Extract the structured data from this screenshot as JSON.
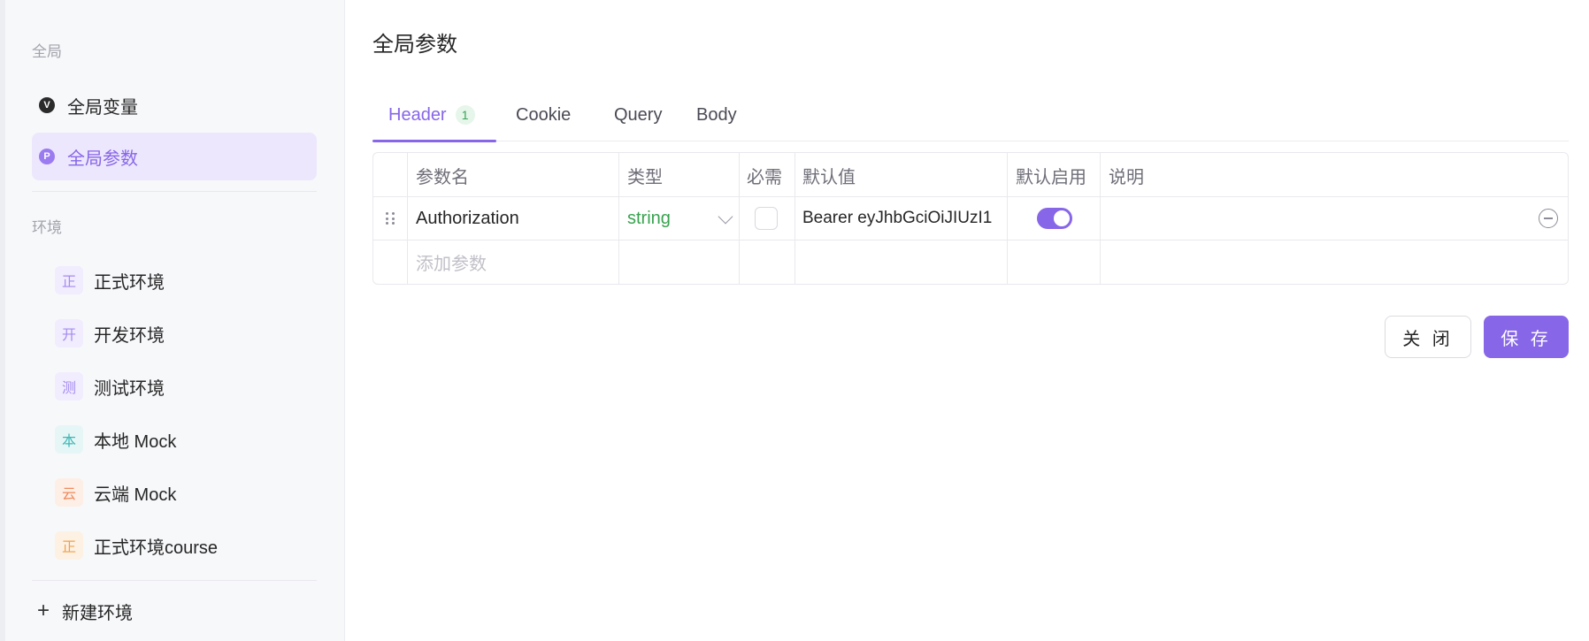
{
  "sidebar": {
    "global_section": "全局",
    "global_items": [
      {
        "label": "全局变量",
        "icon": "v-badge-icon",
        "badge": "V"
      },
      {
        "label": "全局参数",
        "icon": "p-badge-icon",
        "badge": "P",
        "active": true
      }
    ],
    "env_section": "环境",
    "environments": [
      {
        "mark": "正",
        "label": "正式环境",
        "mark_color": "#a58cf0",
        "mark_bg": "#f1ecfe"
      },
      {
        "mark": "开",
        "label": "开发环境",
        "mark_color": "#a58cf0",
        "mark_bg": "#f1ecfe"
      },
      {
        "mark": "测",
        "label": "测试环境",
        "mark_color": "#a58cf0",
        "mark_bg": "#f1ecfe"
      },
      {
        "mark": "本",
        "label": "本地 Mock",
        "mark_color": "#3fb7b7",
        "mark_bg": "#e6f6f6"
      },
      {
        "mark": "云",
        "label": "云端 Mock",
        "mark_color": "#f08a5d",
        "mark_bg": "#fdeee6"
      },
      {
        "mark": "正",
        "label": "正式环境course",
        "mark_color": "#f0a04b",
        "mark_bg": "#fdf1e4"
      }
    ],
    "new_env_label": "新建环境"
  },
  "main": {
    "title": "全局参数",
    "tabs": [
      {
        "label": "Header",
        "count": "1",
        "active": true
      },
      {
        "label": "Cookie"
      },
      {
        "label": "Query"
      },
      {
        "label": "Body"
      }
    ],
    "table": {
      "headers": [
        "参数名",
        "类型",
        "必需",
        "默认值",
        "默认启用",
        "说明"
      ],
      "rows": [
        {
          "name": "Authorization",
          "type": "string",
          "required": false,
          "default": "Bearer eyJhbGciOiJIUzI1",
          "enabled": true,
          "description": ""
        }
      ],
      "add_placeholder": "添加参数"
    },
    "buttons": {
      "close": "关 闭",
      "save": "保 存"
    }
  },
  "colors": {
    "accent": "#8766e8",
    "type_green": "#38a24f",
    "active_bg": "#ede7fd"
  }
}
